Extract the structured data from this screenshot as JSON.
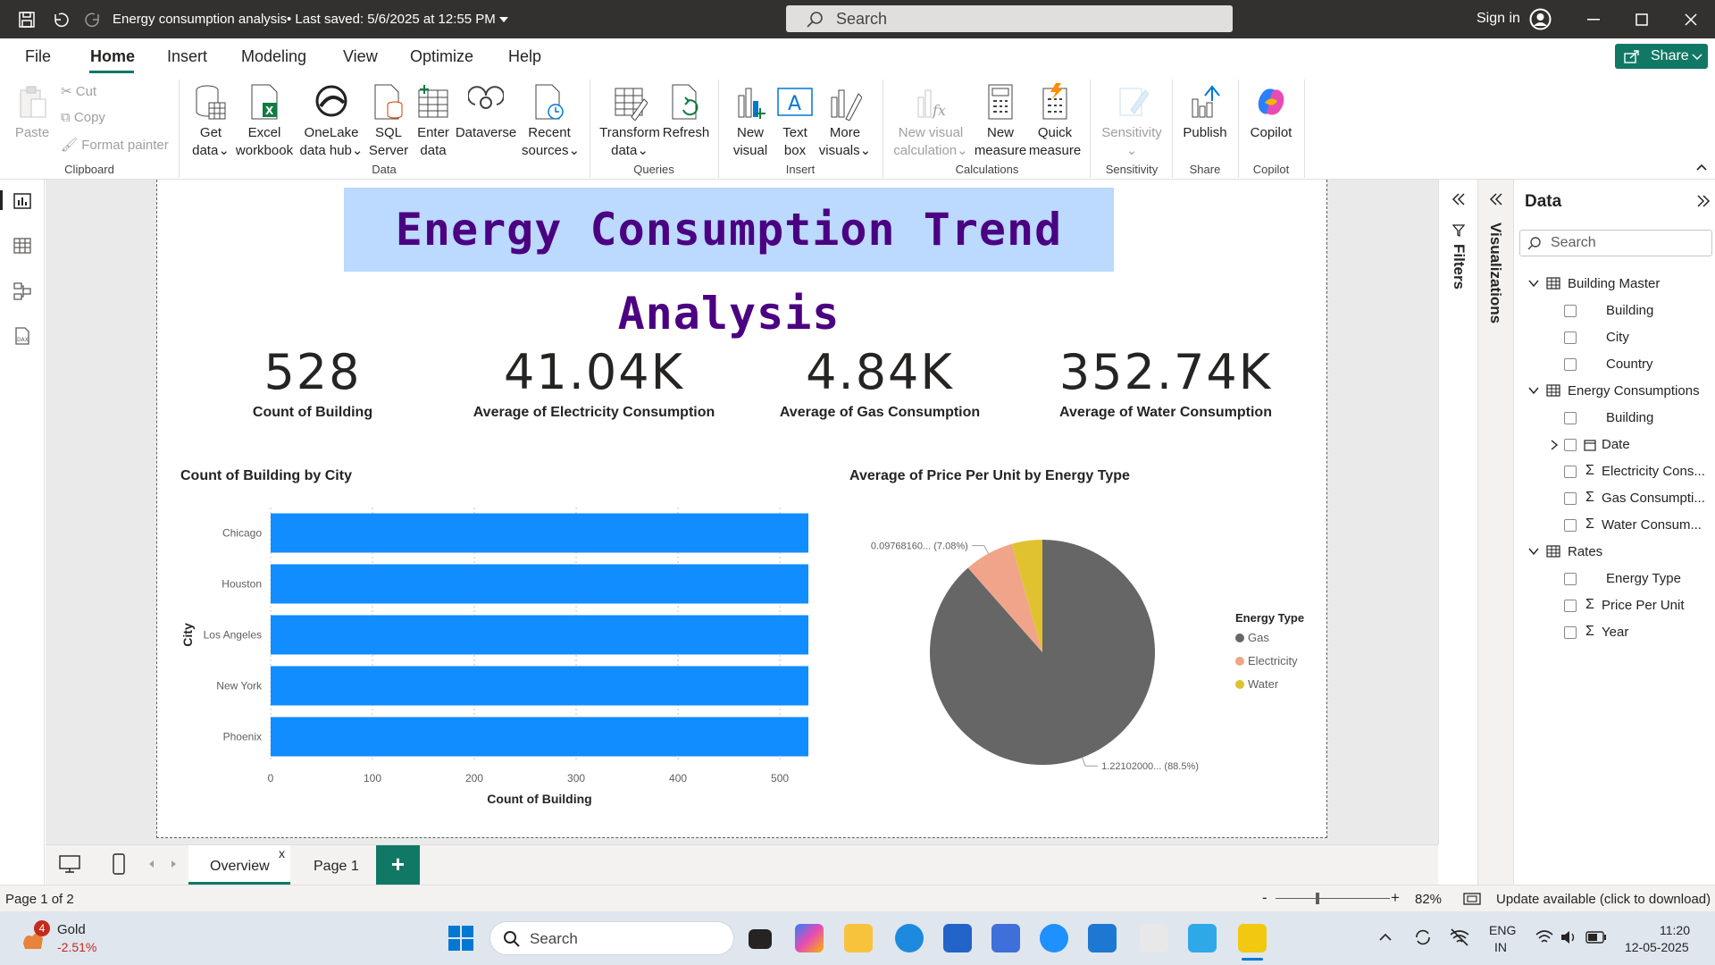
{
  "titlebar": {
    "title": "Energy consumption analysis",
    "saved": "• Last saved: 5/6/2025 at 12:55 PM",
    "search_placeholder": "Search",
    "signin": "Sign in"
  },
  "menu": {
    "items": [
      "File",
      "Home",
      "Insert",
      "Modeling",
      "View",
      "Optimize",
      "Help"
    ],
    "share": "Share"
  },
  "ribbon": {
    "clipboard": {
      "paste": "Paste",
      "cut": "Cut",
      "copy": "Copy",
      "format_painter": "Format painter",
      "group": "Clipboard"
    },
    "data": {
      "get_data": [
        "Get",
        "data"
      ],
      "excel": [
        "Excel",
        "workbook"
      ],
      "onelake": [
        "OneLake",
        "data hub"
      ],
      "sql": [
        "SQL",
        "Server"
      ],
      "enter": [
        "Enter",
        "data"
      ],
      "dataverse": "Dataverse",
      "recent": [
        "Recent",
        "sources"
      ],
      "group": "Data"
    },
    "queries": {
      "transform": [
        "Transform",
        "data"
      ],
      "refresh": "Refresh",
      "group": "Queries"
    },
    "insert": {
      "new_visual": [
        "New",
        "visual"
      ],
      "text_box": [
        "Text",
        "box"
      ],
      "more_visuals": [
        "More",
        "visuals"
      ],
      "group": "Insert"
    },
    "calculations": {
      "new_visual_calc": [
        "New visual",
        "calculation"
      ],
      "new_measure": [
        "New",
        "measure"
      ],
      "quick_measure": [
        "Quick",
        "measure"
      ],
      "group": "Calculations"
    },
    "sensitivity": {
      "label": "Sensitivity",
      "group": "Sensitivity"
    },
    "share": {
      "publish": "Publish",
      "group": "Share"
    },
    "copilot": {
      "label": "Copilot",
      "group": "Copilot"
    }
  },
  "report": {
    "title": "Energy Consumption Trend Analysis",
    "kpis": [
      {
        "value": "528",
        "label": "Count of Building"
      },
      {
        "value": "41.04K",
        "label": "Average of Electricity Consumption"
      },
      {
        "value": "4.84K",
        "label": "Average of Gas Consumption"
      },
      {
        "value": "352.74K",
        "label": "Average of Water Consumption"
      }
    ]
  },
  "chart_data": [
    {
      "type": "bar",
      "orientation": "horizontal",
      "title": "Count of Building by City",
      "categories": [
        "Chicago",
        "Houston",
        "Los Angeles",
        "New York",
        "Phoenix"
      ],
      "values": [
        528,
        528,
        528,
        528,
        528
      ],
      "xlabel": "Count of Building",
      "ylabel": "City",
      "xlim": [
        0,
        528
      ],
      "xticks": [
        0,
        100,
        200,
        300,
        400,
        500
      ],
      "color": "#118dff",
      "grid": true
    },
    {
      "type": "pie",
      "title": "Average of Price Per Unit by Energy Type",
      "legend_title": "Energy Type",
      "legend_position": "right",
      "slices": [
        {
          "name": "Gas",
          "percent": 88.5,
          "label": "1.22102000... (88.5%)",
          "color": "#666666"
        },
        {
          "name": "Electricity",
          "percent": 7.08,
          "label": "0.09768160... (7.08%)",
          "color": "#f0a58a"
        },
        {
          "name": "Water",
          "percent": 4.42,
          "label": "",
          "color": "#e0c231"
        }
      ]
    }
  ],
  "panes": {
    "filters": "Filters",
    "visualizations": "Visualizations",
    "data_title": "Data",
    "search_placeholder": "Search",
    "tables": [
      {
        "name": "Building Master",
        "fields": [
          {
            "name": "Building",
            "sigma": false
          },
          {
            "name": "City",
            "sigma": false
          },
          {
            "name": "Country",
            "sigma": false
          }
        ]
      },
      {
        "name": "Energy Consumptions",
        "fields": [
          {
            "name": "Building",
            "sigma": false
          },
          {
            "name": "Date",
            "sigma": false
          },
          {
            "name": "Electricity Cons...",
            "sigma": true
          },
          {
            "name": "Gas Consumpti...",
            "sigma": true
          },
          {
            "name": "Water Consum...",
            "sigma": true
          }
        ]
      },
      {
        "name": "Rates",
        "fields": [
          {
            "name": "Energy Type",
            "sigma": false
          },
          {
            "name": "Price Per Unit",
            "sigma": true
          },
          {
            "name": "Year",
            "sigma": true
          }
        ]
      }
    ]
  },
  "tabs": {
    "overview": "Overview",
    "page1": "Page 1",
    "close": "x",
    "add": "+"
  },
  "status": {
    "page": "Page 1 of 2",
    "zoom": "82%",
    "update": "Update available (click to download)",
    "zoom_minus": "-",
    "zoom_plus": "+"
  },
  "taskbar": {
    "stock_name": "Gold",
    "stock_change": "-2.51%",
    "badge": "4",
    "search": "Search",
    "lang": "ENG",
    "region": "IN",
    "time": "11:20",
    "date": "12-05-2025"
  }
}
